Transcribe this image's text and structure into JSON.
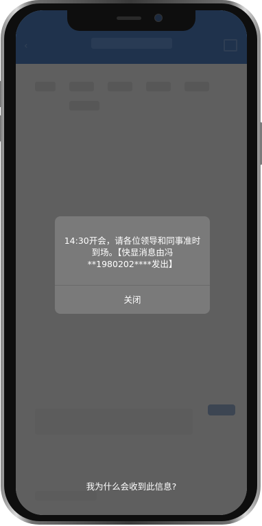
{
  "notification": {
    "message": "14:30开会，请各位领导和同事准时到场。【快显消息由冯**1980202****发出】",
    "close_label": "关闭"
  },
  "footer": {
    "why_label": "我为什么会收到此信息?"
  },
  "colors": {
    "app_header": "#0a4ea8",
    "overlay": "rgba(40,40,40,0.72)",
    "dialog_bg": "#7a7a7a"
  }
}
